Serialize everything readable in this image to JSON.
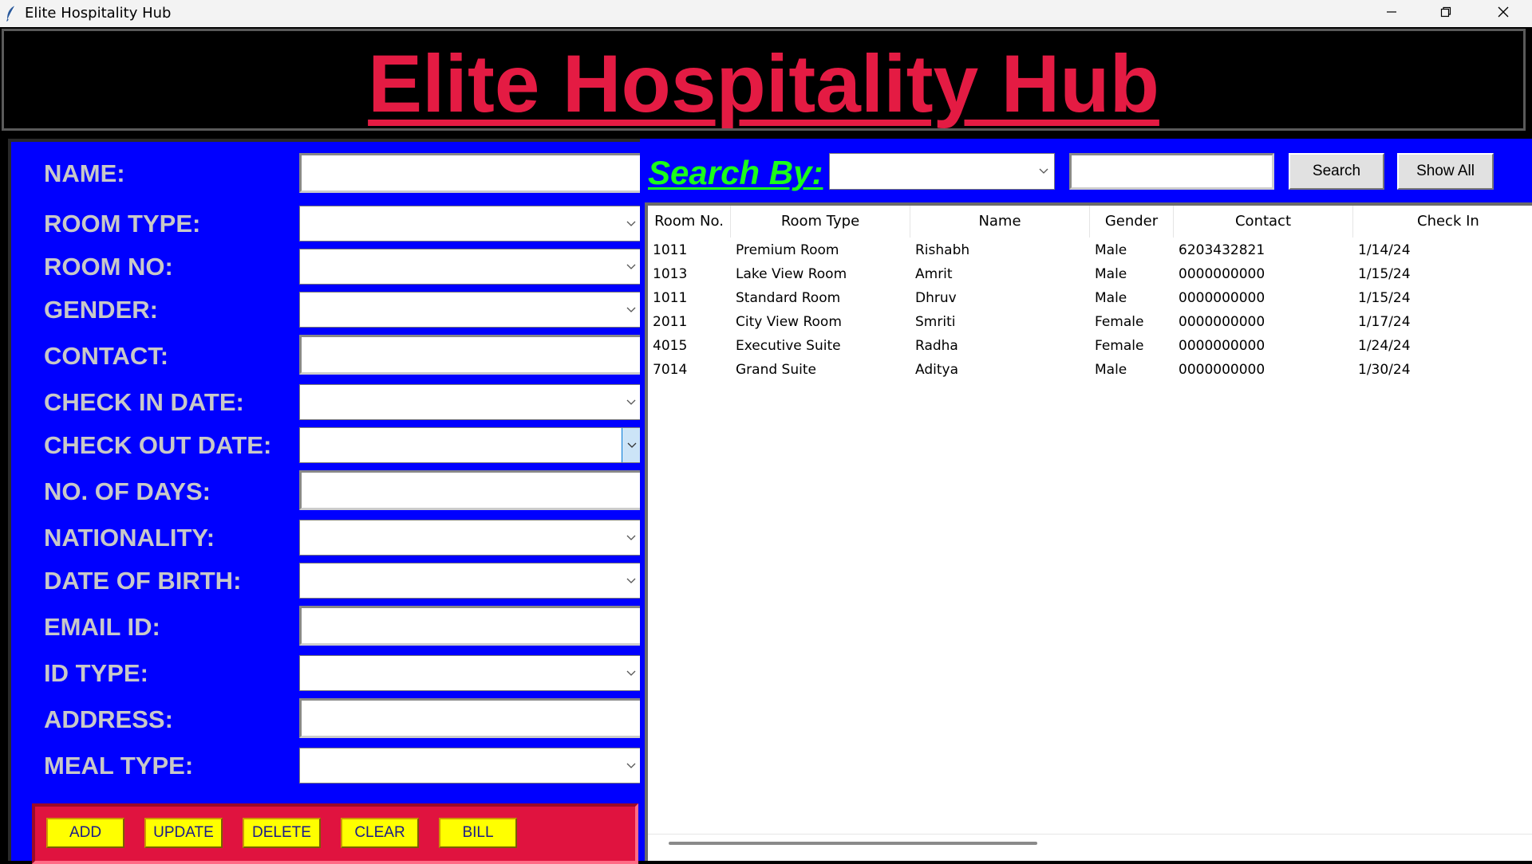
{
  "window": {
    "title": "Elite Hospitality Hub",
    "controls": [
      "minimize-icon",
      "restore-icon",
      "close-icon"
    ]
  },
  "header": {
    "title": "Elite Hospitality Hub",
    "title_color": "#e41b43",
    "background": "#000000"
  },
  "form": {
    "panel_color": "#0000ff",
    "fields": [
      {
        "label": "NAME:",
        "kind": "entry",
        "value": ""
      },
      {
        "label": "ROOM TYPE:",
        "kind": "combo",
        "value": ""
      },
      {
        "label": "ROOM NO:",
        "kind": "combo",
        "value": ""
      },
      {
        "label": "GENDER:",
        "kind": "combo",
        "value": ""
      },
      {
        "label": "CONTACT:",
        "kind": "entry",
        "value": ""
      },
      {
        "label": "CHECK IN DATE:",
        "kind": "combo",
        "value": ""
      },
      {
        "label": "CHECK OUT DATE:",
        "kind": "combo",
        "value": ""
      },
      {
        "label": "NO. OF DAYS:",
        "kind": "entry",
        "value": ""
      },
      {
        "label": "NATIONALITY:",
        "kind": "combo",
        "value": ""
      },
      {
        "label": "DATE OF BIRTH:",
        "kind": "combo",
        "value": ""
      },
      {
        "label": "EMAIL ID:",
        "kind": "entry",
        "value": ""
      },
      {
        "label": "ID TYPE:",
        "kind": "combo",
        "value": ""
      },
      {
        "label": "ADDRESS:",
        "kind": "entry",
        "value": ""
      },
      {
        "label": "MEAL TYPE:",
        "kind": "combo",
        "value": ""
      }
    ],
    "buttons": {
      "add": "ADD",
      "update": "UPDATE",
      "delete": "DELETE",
      "clear": "CLEAR",
      "bill": "BILL"
    },
    "button_bar_color": "#e0133f",
    "button_color": "#ffff00"
  },
  "search": {
    "label": "Search By:",
    "label_color": "#1aff1a",
    "by_value": "",
    "query_value": "",
    "search_button": "Search",
    "show_all_button": "Show All"
  },
  "table": {
    "columns": [
      "Room No.",
      "Room Type",
      "Name",
      "Gender",
      "Contact",
      "Check In"
    ],
    "rows": [
      [
        "1011",
        "Premium Room",
        "Rishabh",
        "Male",
        "6203432821",
        "1/14/24"
      ],
      [
        "1013",
        "Lake View Room",
        "Amrit",
        "Male",
        "0000000000",
        "1/15/24"
      ],
      [
        "1011",
        "Standard Room",
        "Dhruv",
        "Male",
        "0000000000",
        "1/15/24"
      ],
      [
        "2011",
        "City View Room",
        "Smriti",
        "Female",
        "0000000000",
        "1/17/24"
      ],
      [
        "4015",
        "Executive Suite",
        "Radha",
        "Female",
        "0000000000",
        "1/24/24"
      ],
      [
        "7014",
        "Grand Suite",
        "Aditya",
        "Male",
        "0000000000",
        "1/30/24"
      ]
    ]
  }
}
